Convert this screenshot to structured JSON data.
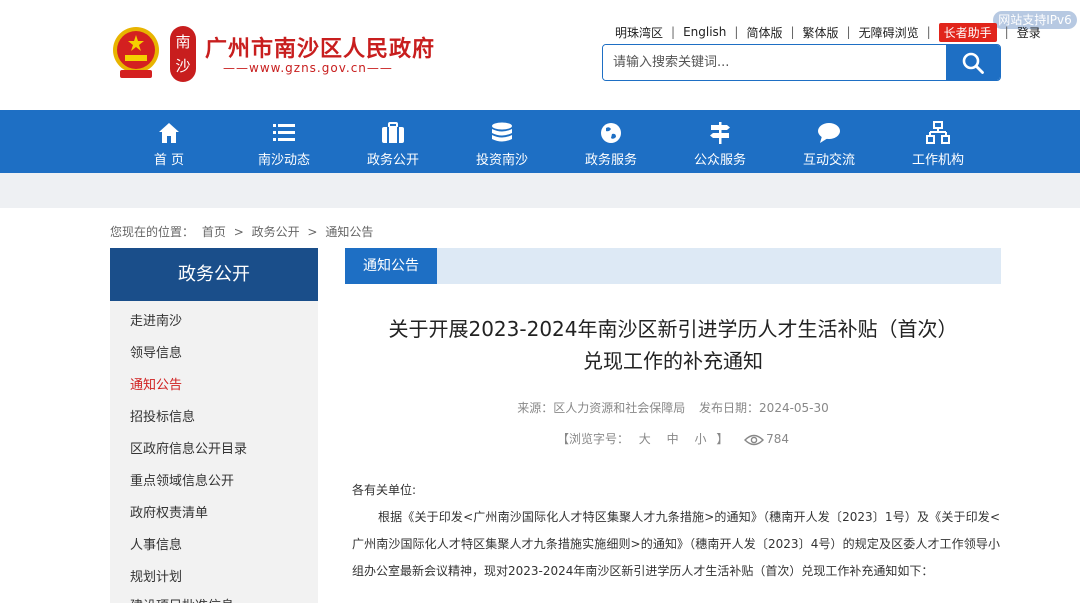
{
  "header": {
    "site_title": "广州市南沙区人民政府",
    "site_url": "——www.gzns.gov.cn——",
    "seal_text": "南沙",
    "ipv6_badge": "网站支持IPv6",
    "top_links": [
      "明珠湾区",
      "English",
      "简体版",
      "繁体版",
      "无障碍浏览",
      "长者助手",
      "登录"
    ],
    "search": {
      "placeholder": "请输入搜索关键词..."
    }
  },
  "nav": {
    "items": [
      {
        "label": "首 页",
        "icon": "home-icon"
      },
      {
        "label": "南沙动态",
        "icon": "list-icon"
      },
      {
        "label": "政务公开",
        "icon": "briefcase-icon"
      },
      {
        "label": "投资南沙",
        "icon": "coins-icon"
      },
      {
        "label": "政务服务",
        "icon": "globe-icon"
      },
      {
        "label": "公众服务",
        "icon": "signpost-icon"
      },
      {
        "label": "互动交流",
        "icon": "chat-icon"
      },
      {
        "label": "工作机构",
        "icon": "org-chart-icon"
      }
    ]
  },
  "breadcrumb": {
    "prefix": "您现在的位置：",
    "items": [
      "首页",
      "政务公开",
      "通知公告"
    ],
    "separator": ">"
  },
  "sidebar": {
    "title": "政务公开",
    "items": [
      "走进南沙",
      "领导信息",
      "通知公告",
      "招投标信息",
      "区政府信息公开目录",
      "重点领域信息公开",
      "政府权责清单",
      "人事信息",
      "规划计划",
      "建设项目批准信息"
    ],
    "active_index": 2
  },
  "content": {
    "tab_label": "通知公告",
    "title_line1": "关于开展2023-2024年南沙区新引进学历人才生活补贴（首次）",
    "title_line2": "兑现工作的补充通知",
    "source": "来源：区人力资源和社会保障局",
    "publish_date": "发布日期：2024-05-30",
    "font_size_label": "【浏览字号：",
    "font_sizes": [
      "大",
      "中",
      "小"
    ],
    "font_size_close": "】",
    "view_count": "784",
    "salutation": "各有关单位:",
    "paragraph": "根据《关于印发<广州南沙国际化人才特区集聚人才九条措施>的通知》（穗南开人发〔2023〕1号）及《关于印发<广州南沙国际化人才特区集聚人才九条措施实施细则>的通知》（穗南开人发〔2023〕4号）的规定及区委人才工作领导小组办公室最新会议精神，现对2023-2024年南沙区新引进学历人才生活补贴（首次）兑现工作补充通知如下："
  },
  "colors": {
    "brand_blue": "#1e6fc4",
    "sidebar_header": "#1a4e8a",
    "brand_red": "#c81e1e",
    "active_red": "#d02020"
  }
}
